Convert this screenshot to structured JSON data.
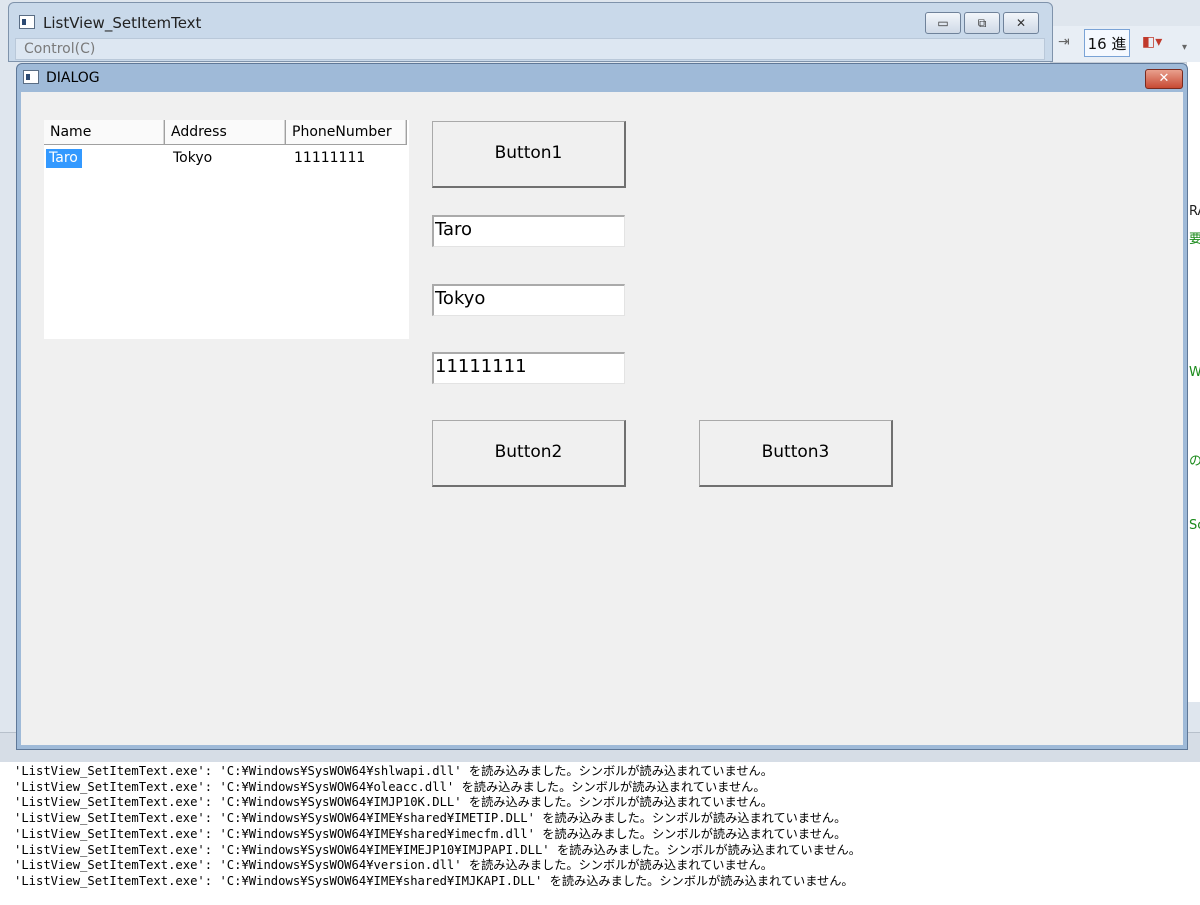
{
  "parent_window": {
    "title": "ListView_SetItemText",
    "menu_control": "Control(C)",
    "minimize": "▭",
    "restore": "⧉",
    "close": "✕"
  },
  "ide": {
    "hex_button": "16 進",
    "right_fragments": [
      "RA",
      "要",
      "Wi",
      "の",
      "Sc"
    ]
  },
  "dialog": {
    "title": "DIALOG",
    "close": "✕",
    "listview": {
      "columns": [
        "Name",
        "Address",
        "PhoneNumber"
      ],
      "rows": [
        {
          "name": "Taro",
          "address": "Tokyo",
          "phone": "11111111"
        }
      ]
    },
    "button1_label": "Button1",
    "button2_label": "Button2",
    "button3_label": "Button3",
    "edit_name_value": "Taro",
    "edit_address_value": "Tokyo",
    "edit_phone_value": "11111111"
  },
  "output": {
    "lines": [
      "'ListView_SetItemText.exe': 'C:¥Windows¥SysWOW64¥shlwapi.dll' を読み込みました。シンボルが読み込まれていません。",
      "'ListView_SetItemText.exe': 'C:¥Windows¥SysWOW64¥oleacc.dll' を読み込みました。シンボルが読み込まれていません。",
      "'ListView_SetItemText.exe': 'C:¥Windows¥SysWOW64¥IMJP10K.DLL' を読み込みました。シンボルが読み込まれていません。",
      "'ListView_SetItemText.exe': 'C:¥Windows¥SysWOW64¥IME¥shared¥IMETIP.DLL' を読み込みました。シンボルが読み込まれていません。",
      "'ListView_SetItemText.exe': 'C:¥Windows¥SysWOW64¥IME¥shared¥imecfm.dll' を読み込みました。シンボルが読み込まれていません。",
      "'ListView_SetItemText.exe': 'C:¥Windows¥SysWOW64¥IME¥IMEJP10¥IMJPAPI.DLL' を読み込みました。シンボルが読み込まれていません。",
      "'ListView_SetItemText.exe': 'C:¥Windows¥SysWOW64¥version.dll' を読み込みました。シンボルが読み込まれていません。",
      "'ListView_SetItemText.exe': 'C:¥Windows¥SysWOW64¥IME¥shared¥IMJKAPI.DLL' を読み込みました。シンボルが読み込まれていません。"
    ]
  }
}
